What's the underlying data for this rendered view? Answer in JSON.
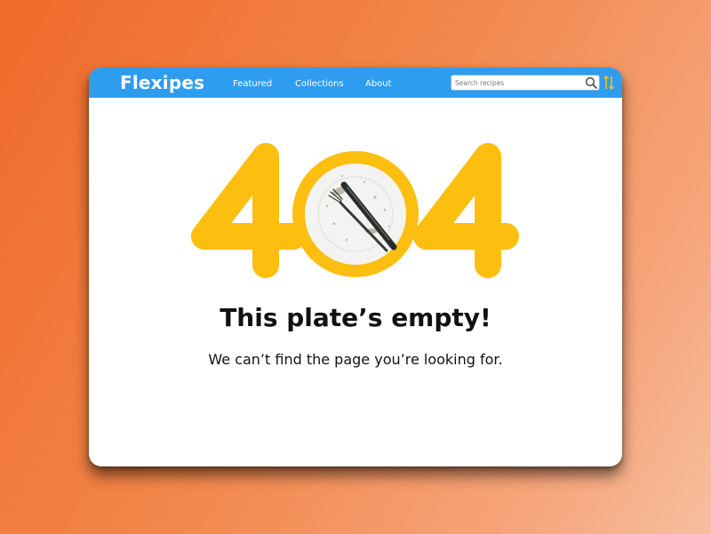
{
  "app": {
    "brand": "Flexipes"
  },
  "nav": {
    "items": [
      {
        "label": "Featured"
      },
      {
        "label": "Collections"
      },
      {
        "label": "About"
      }
    ]
  },
  "search": {
    "placeholder": "Search recipes",
    "value": ""
  },
  "error": {
    "code_left": "4",
    "code_right": "4",
    "title": "This plate’s empty!",
    "message": "We can’t find the page you’re looking for."
  },
  "colors": {
    "accent_yellow": "#fcbe0f",
    "nav_blue": "#2e9df0",
    "background_orange": "#f06a2a"
  },
  "icons": {
    "search": "search-icon",
    "sort": "sort-arrows-icon",
    "plate": "dirty-plate-illustration"
  }
}
